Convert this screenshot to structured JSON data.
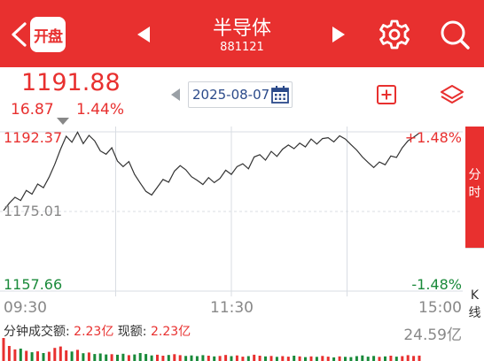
{
  "header": {
    "logo_text": "开盘",
    "title": "半导体",
    "code": "881121",
    "icons": [
      "back-icon",
      "prev-icon",
      "next-icon",
      "gear-icon",
      "search-icon"
    ]
  },
  "quote": {
    "price": "1191.88",
    "change": "16.87",
    "change_pct": "1.44%",
    "date": "2025-08-07"
  },
  "chart": {
    "high_price": "1192.37",
    "high_pct": "+1.48%",
    "prev_close": "1175.01",
    "low_price": "1157.66",
    "low_pct": "-1.48%",
    "time_start": "09:30",
    "time_mid": "11:30",
    "time_end": "15:00"
  },
  "tabs": {
    "fenshi": [
      "分",
      "时"
    ],
    "kline": [
      "K",
      "线"
    ]
  },
  "volume": {
    "label_prefix": "分钟成交额: ",
    "amount": "2.23亿",
    "label_now": " 现额: ",
    "now": "2.23亿",
    "max": "24.59亿"
  },
  "colors": {
    "brand_red": "#e8302f",
    "down_green": "#1a8a3a",
    "grid": "#d9dde3"
  },
  "chart_data": {
    "type": "line",
    "ylim": [
      1157.66,
      1192.37
    ],
    "prev_close": 1175.01,
    "x": [
      0,
      1,
      2,
      3,
      4,
      5,
      6,
      7,
      8,
      9,
      10,
      11,
      12,
      13,
      14,
      15,
      16,
      17,
      18,
      19,
      20,
      21,
      22,
      23,
      24,
      25,
      26,
      27,
      28,
      29,
      30,
      31,
      32,
      33,
      34,
      35,
      36,
      37,
      38,
      39,
      40,
      41,
      42,
      43,
      44,
      45,
      46,
      47,
      48,
      49,
      50,
      51,
      52,
      53,
      54,
      55,
      56,
      57,
      58,
      59,
      60,
      61,
      62,
      63,
      64,
      65,
      66,
      67,
      68,
      69,
      70,
      71,
      72,
      73,
      74,
      75,
      76,
      77,
      78,
      79,
      80
    ],
    "values": [
      1175.2,
      1176.8,
      1178.1,
      1177.4,
      1179.6,
      1178.8,
      1181.0,
      1180.2,
      1182.5,
      1185.3,
      1188.6,
      1191.4,
      1190.1,
      1192.3,
      1189.8,
      1191.6,
      1190.4,
      1188.2,
      1187.5,
      1188.9,
      1186.0,
      1184.8,
      1185.9,
      1183.1,
      1181.2,
      1179.4,
      1178.6,
      1180.3,
      1182.0,
      1181.4,
      1183.8,
      1185.0,
      1184.1,
      1182.6,
      1181.8,
      1180.9,
      1182.4,
      1181.3,
      1182.2,
      1184.0,
      1183.1,
      1184.8,
      1185.4,
      1184.3,
      1186.9,
      1187.4,
      1186.2,
      1188.1,
      1187.0,
      1188.6,
      1189.5,
      1188.7,
      1189.9,
      1189.1,
      1190.8,
      1189.7,
      1190.9,
      1191.1,
      1190.2,
      1191.5,
      1190.8,
      1189.6,
      1188.4,
      1186.9,
      1185.7,
      1184.6,
      1185.8,
      1185.2,
      1187.1,
      1186.8,
      1188.9,
      1190.4,
      1191.2,
      1192.1,
      null,
      null,
      null,
      null,
      null,
      null,
      null
    ],
    "volumes": [
      9.5,
      6.2,
      4.8,
      5.1,
      4.2,
      3.6,
      4.0,
      3.3,
      3.8,
      5.4,
      6.0,
      4.4,
      3.9,
      4.6,
      3.2,
      3.5,
      2.9,
      3.1,
      2.7,
      2.8,
      2.6,
      3.0,
      2.4,
      2.7,
      3.3,
      2.9,
      2.3,
      2.6,
      2.2,
      2.5,
      2.8,
      2.4,
      2.1,
      2.3,
      2.0,
      2.4,
      2.2,
      1.9,
      2.1,
      2.5,
      2.0,
      2.3,
      1.8,
      2.0,
      2.6,
      2.2,
      1.9,
      2.1,
      1.7,
      2.0,
      1.8,
      2.2,
      1.9,
      1.6,
      1.9,
      1.7,
      2.1,
      1.8,
      1.5,
      1.9,
      1.7,
      1.6,
      2.0,
      2.3,
      1.8,
      2.1,
      1.7,
      1.9,
      2.2,
      1.8,
      2.0,
      2.4,
      2.1,
      2.23
    ]
  }
}
